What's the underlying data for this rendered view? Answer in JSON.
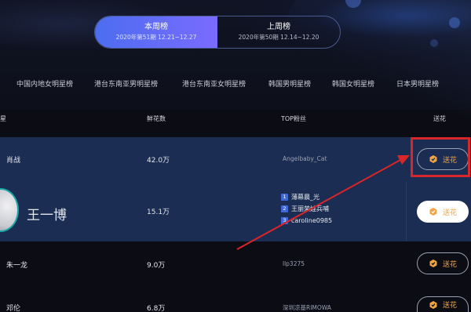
{
  "week_switch": {
    "current": {
      "title": "本周榜",
      "dates": "2020年第51期 12.21~12.27"
    },
    "previous": {
      "title": "上周榜",
      "dates": "2020年第50期 12.14~12.20"
    }
  },
  "categories": [
    "中国内地女明星榜",
    "港台东南亚男明星榜",
    "港台东南亚女明星榜",
    "韩国男明星榜",
    "韩国女明星榜",
    "日本男明星榜"
  ],
  "table": {
    "headers": {
      "star": "星",
      "flowers": "鲜花数",
      "top_fans": "TOP粉丝",
      "gift": "送花"
    },
    "rows": [
      {
        "name": "肖战",
        "flowers": "42.0万",
        "top_fan": "Angelbaby_Cat"
      },
      {
        "name": "王一博",
        "flowers": "15.1万",
        "fans": [
          {
            "rank": "1",
            "name": "薄幕晨_光"
          },
          {
            "rank": "2",
            "name": "王丽荣娃兵哺"
          },
          {
            "rank": "3",
            "name": "caroline0985"
          }
        ]
      },
      {
        "name": "朱一龙",
        "flowers": "9.0万",
        "top_fan": "llp3275"
      },
      {
        "name": "邓伦",
        "flowers": "6.8万",
        "top_fan": "深圳凉基RIMOWA"
      }
    ]
  },
  "gift_button_label": "送花",
  "colors": {
    "accent_gradient_start": "#4c6df0",
    "accent_gradient_end": "#7a6bff",
    "highlight_row": "#1b2d52",
    "gift_orange": "#f2a445",
    "annotation_red": "#d8262b"
  }
}
